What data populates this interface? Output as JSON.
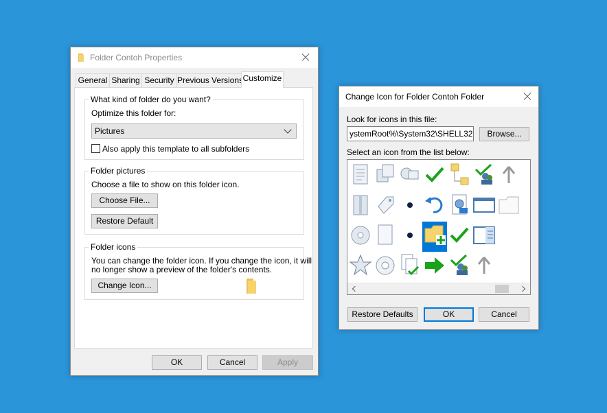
{
  "properties_dialog": {
    "title": "Folder Contoh Properties",
    "tabs": [
      "General",
      "Sharing",
      "Security",
      "Previous Versions",
      "Customize"
    ],
    "active_tab": "Customize",
    "group_template": {
      "title": "What kind of folder do you want?",
      "optimize_label": "Optimize this folder for:",
      "optimize_value": "Pictures",
      "subfolders_checkbox_label": "Also apply this template to all subfolders",
      "subfolders_checked": false
    },
    "group_pictures": {
      "title": "Folder pictures",
      "description": "Choose a file to show on this folder icon.",
      "choose_file_button": "Choose File...",
      "restore_default_button": "Restore Default"
    },
    "group_icons": {
      "title": "Folder icons",
      "description_line1": "You can change the folder icon. If you change the icon, it will",
      "description_line2": "no longer show a preview of the folder's contents.",
      "change_icon_button": "Change Icon..."
    },
    "buttons": {
      "ok": "OK",
      "cancel": "Cancel",
      "apply": "Apply"
    }
  },
  "change_icon_dialog": {
    "title": "Change Icon for Folder Contoh Folder",
    "look_label": "Look for icons in this file:",
    "file_path": "ystemRoot%\\System32\\SHELL32.dll",
    "browse_button": "Browse...",
    "select_label": "Select an icon from the list below:",
    "icons": [
      "document-icon",
      "windows-icon",
      "network-places-icon",
      "checkmark-icon",
      "folder-tree-icon",
      "user-check-icon",
      "up-arrow-icon",
      "partial-icon",
      "book-icon",
      "tag-icon",
      "bullet-dot-icon",
      "undo-arrow-icon",
      "settings-document-icon",
      "window-frame-icon",
      "blank-folder-icon",
      "partial-icon",
      "cd-drive-icon",
      "blank-page-icon",
      "bullet-dot-icon",
      "folder-add-icon",
      "checkmark-icon",
      "details-pane-icon",
      "empty-icon",
      "partial-icon",
      "star-icon",
      "disc-icon",
      "copy-check-icon",
      "right-arrow-icon",
      "user-check-icon",
      "up-arrow-icon",
      "empty-icon",
      "partial-icon"
    ],
    "selected_icon_index": 19,
    "buttons": {
      "restore_defaults": "Restore Defaults",
      "ok": "OK",
      "cancel": "Cancel"
    }
  },
  "colors": {
    "desktop": "#2b95d9",
    "accent": "#0078d7",
    "check_green": "#1aa31a",
    "folder_yellow": "#f6d36b"
  }
}
